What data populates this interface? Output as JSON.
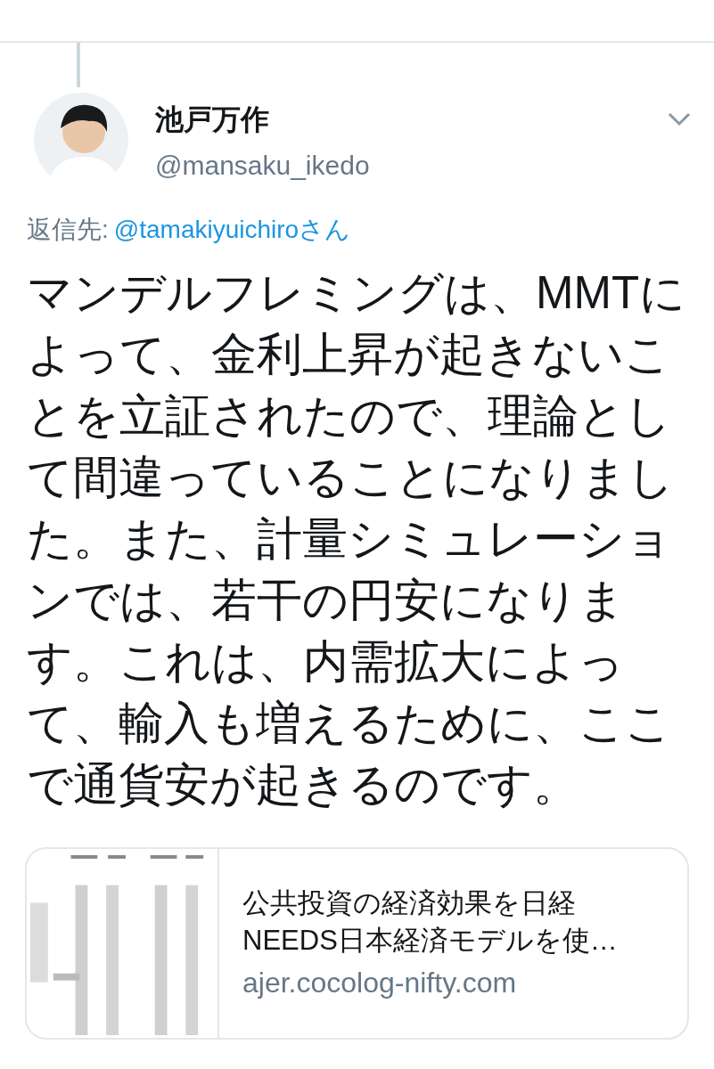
{
  "tweet": {
    "author_name": "池戸万作",
    "handle": "@mansaku_ikedo",
    "reply_to": {
      "label": "返信先:",
      "handle": "@tamakiyuichiroさん"
    },
    "text": "マンデルフレミングは、MMTによって、金利上昇が起きないことを立証されたので、理論として間違っていることになりました。また、計量シミュレーションでは、若干の円安になります。これは、内需拡大によって、輸入も増えるために、ここで通貨安が起きるのです。",
    "link_card": {
      "title_lines": [
        "公共投資の経済効果を日経",
        "NEEDS日本経済モデルを使…"
      ],
      "domain": "ajer.cocolog-nifty.com"
    }
  }
}
